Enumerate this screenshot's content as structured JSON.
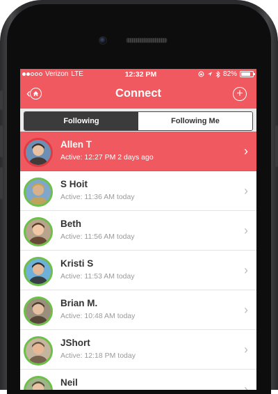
{
  "status_bar": {
    "carrier": "Verizon",
    "network": "LTE",
    "time": "12:32 PM",
    "battery": "82%",
    "battery_level": 0.82
  },
  "nav": {
    "title": "Connect",
    "back_icon": "chevron-left-icon",
    "home_icon": "home-icon",
    "add_icon": "plus-icon"
  },
  "tabs": [
    {
      "label": "Following",
      "active": true
    },
    {
      "label": "Following Me",
      "active": false
    }
  ],
  "contacts": [
    {
      "name": "Allen T",
      "activity": "Active: 12:27 PM 2 days ago",
      "highlighted": true
    },
    {
      "name": "S Hoit",
      "activity": "Active: 11:36 AM today",
      "highlighted": false
    },
    {
      "name": "Beth",
      "activity": "Active: 11:56 AM today",
      "highlighted": false
    },
    {
      "name": "Kristi S",
      "activity": "Active: 11:53 AM today",
      "highlighted": false
    },
    {
      "name": "Brian M.",
      "activity": "Active: 10:48 AM today",
      "highlighted": false
    },
    {
      "name": "JShort",
      "activity": "Active: 12:18 PM today",
      "highlighted": false
    },
    {
      "name": "Neil",
      "activity": "",
      "highlighted": false
    }
  ],
  "colors": {
    "accent": "#f0595f",
    "active_ring": "#6cc04a",
    "segment_active": "#3b3b3b"
  }
}
